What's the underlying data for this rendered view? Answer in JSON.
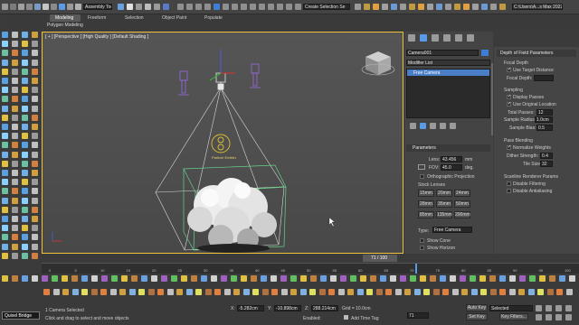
{
  "window": {
    "title_field": "Assembly Tool",
    "search_field": "Create Selection Se",
    "path_field": "C:\\Users\\A...s Max 2022"
  },
  "ribbon": {
    "tabs": [
      "Modeling",
      "Freeform",
      "Selection",
      "Object Paint",
      "Populate"
    ],
    "active_tab_label": "Polygon Modeling"
  },
  "viewport": {
    "label": "[ + ] [Perspective ] [High Quality ] [Default Shading ]",
    "particle_label": "Particle Emitter"
  },
  "command_panel": {
    "object_name": "Camera001",
    "modifier_list_label": "Modifier List",
    "stack_item": "Free Camera",
    "parameters": {
      "title": "Parameters",
      "lens_label": "Lens:",
      "lens_value": "43.456",
      "lens_unit": "mm",
      "fov_label": "FOV:",
      "fov_value": "45.0",
      "fov_unit": "deg.",
      "ortho_label": "Orthographic Projection",
      "stock_label": "Stock Lenses",
      "lenses": [
        "15mm",
        "20mm",
        "24mm",
        "28mm",
        "35mm",
        "50mm",
        "85mm",
        "135mm",
        "200mm"
      ],
      "type_label": "Type:",
      "type_value": "Free Camera",
      "show_cone": "Show Cone",
      "show_horizon": "Show Horizon"
    }
  },
  "dof": {
    "title": "Depth of Field Parameters",
    "focal_depth": "Focal Depth",
    "use_target": "Use Target Distance",
    "focal_depth_label": "Focal Depth:",
    "sampling": "Sampling",
    "display_passes": "Display Passes",
    "use_original": "Use Original Location",
    "total_passes_label": "Total Passes:",
    "total_passes": "12",
    "sample_radius_label": "Sample Radius:",
    "sample_radius": "1.0cm",
    "sample_bias_label": "Sample Bias:",
    "sample_bias": "0.5",
    "pass_blending": "Pass Blending",
    "normalize": "Normalize Weights",
    "dither_label": "Dither Strength:",
    "dither": "0.4",
    "tile_label": "Tile Size:",
    "tile": "32",
    "scanline": "Scanline Renderer Params",
    "disable_filtering": "Disable Filtering",
    "disable_antialias": "Disable Antialiasing"
  },
  "timeline": {
    "frame": "71 / 100",
    "ticks": [
      "0",
      "5",
      "10",
      "15",
      "20",
      "25",
      "30",
      "35",
      "40",
      "45",
      "50",
      "55",
      "60",
      "65",
      "70",
      "75",
      "80",
      "85",
      "90",
      "95",
      "100"
    ]
  },
  "status": {
    "selected": "1 Camera Selected",
    "hint": "Click and drag to select and move objects",
    "brand": "Quixel Bridge",
    "x_label": "X:",
    "x_value": "-5.282cm",
    "y_label": "Y:",
    "y_value": "-10.898cm",
    "z_label": "Z:",
    "z_value": "288.214cm",
    "grid": "Grid = 10.0cm",
    "enabled": "Enabled:",
    "add_time_tag": "Add Time Tag",
    "autokey": "Auto Key",
    "selected_dd": "Selected",
    "set_key": "Set Key",
    "key_filters": "Key Filters...",
    "frame_field": "71"
  }
}
